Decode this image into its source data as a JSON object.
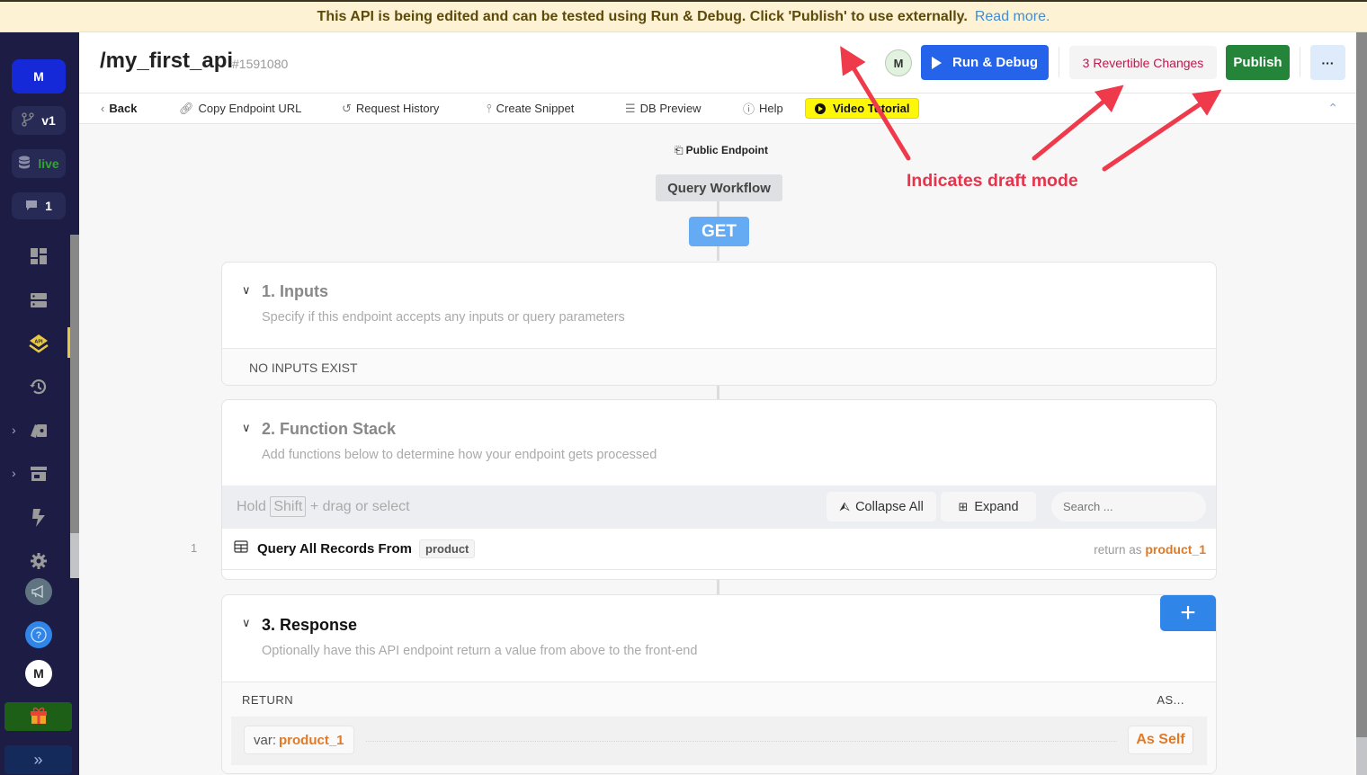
{
  "banner": {
    "message": "This API is being edited and can be tested using Run & Debug. Click 'Publish' to use externally.",
    "link": "Read more."
  },
  "sidebar": {
    "workspace_initial": "M",
    "branch": "v1",
    "datasource": "live",
    "comments_count": "1",
    "nav_icons": [
      "dashboard-icon",
      "database-icon",
      "api-icon",
      "history-icon",
      "library-icon",
      "marketplace-icon",
      "tasks-icon",
      "settings-icon"
    ],
    "active_item": "api-icon",
    "user_initial": "M",
    "accent_color": "#e8c940"
  },
  "header": {
    "title": "/my_first_api",
    "id": "#1591080",
    "avatar_initial": "M",
    "run_label": "Run & Debug",
    "revertible_label": "3 Revertible Changes",
    "publish_label": "Publish",
    "more_label": "···"
  },
  "toolbar": {
    "back": "Back",
    "copy_url": "Copy Endpoint URL",
    "request_history": "Request History",
    "create_snippet": "Create Snippet",
    "db_preview": "DB Preview",
    "help": "Help",
    "video_tutorial": "Video Tutorial"
  },
  "workflow": {
    "public_endpoint": "Public Endpoint",
    "type": "Query Workflow",
    "method": "GET"
  },
  "inputs": {
    "title": "1. Inputs",
    "subtitle": "Specify if this endpoint accepts any inputs or query parameters",
    "empty": "NO INPUTS EXIST"
  },
  "function_stack": {
    "title": "2. Function Stack",
    "subtitle": "Add functions below to determine how your endpoint gets processed",
    "hint_prefix": "Hold",
    "hint_key": "Shift",
    "hint_suffix": "+ drag or select",
    "collapse_all": "Collapse All",
    "expand": "Expand",
    "search_placeholder": "Search ...",
    "steps": [
      {
        "number": "1",
        "label": "Query All Records From",
        "table": "product",
        "return_prefix": "return as",
        "return_var": "product_1"
      }
    ]
  },
  "response": {
    "title": "3. Response",
    "subtitle": "Optionally have this API endpoint return a value from above to the front-end",
    "col_return": "RETURN",
    "col_as": "AS...",
    "var_prefix": "var:",
    "var_name": "product_1",
    "as_value": "As Self"
  },
  "annotation": {
    "text": "Indicates draft mode",
    "color": "#e8334a"
  },
  "colors": {
    "run_button": "#2563eb",
    "publish_button": "#23843a",
    "revertible_text": "#c5174d",
    "variable": "#e07a26",
    "banner_bg": "#fdf3d4"
  }
}
